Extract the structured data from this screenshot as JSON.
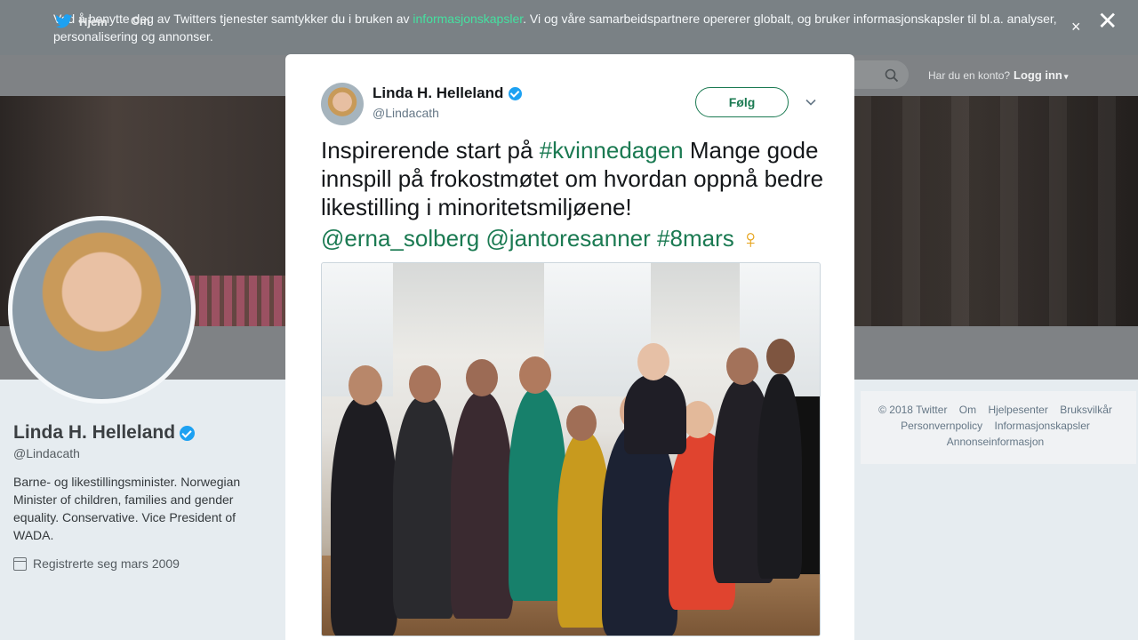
{
  "cookie_banner": {
    "text_before": "Ved å benytte deg av Twitters tjenester samtykker du i bruken av ",
    "link": "informasjonskapsler",
    "text_after": ". Vi og våre samarbeidspartnere opererer globalt, og bruker informasjonskapsler til bl.a. analyser, personalisering og annonser.",
    "close_small": "×",
    "close_big": "✕"
  },
  "nav": {
    "home": "Hjem",
    "about": "Om",
    "account_question": "Har du en konto?",
    "login": "Logg inn",
    "login_caret": "▾"
  },
  "profile": {
    "name": "Linda H. Helleland",
    "handle": "@Lindacath",
    "bio": "Barne- og likestillingsminister. Norwegian Minister of children, families and gender equality. Conservative. Vice President of WADA.",
    "joined": "Registrerte seg mars 2009"
  },
  "footer": {
    "copyright": "© 2018 Twitter",
    "about": "Om",
    "help": "Hjelpesenter",
    "terms": "Bruksvilkår",
    "privacy": "Personvernpolicy",
    "cookies": "Informasjonskapsler",
    "ads": "Annonseinformasjon"
  },
  "tweet": {
    "author_name": "Linda H. Helleland",
    "author_handle": "@Lindacath",
    "follow_label": "Følg",
    "text_part1": "Inspirerende start på ",
    "hashtag1": "#kvinnedagen",
    "text_part2": " Mange gode innspill på frokostmøtet om hvordan oppnå bedre likestilling i minoritetsmiljøene!",
    "mention1": "@erna_solberg",
    "mention2": "@jantoresanner",
    "hashtag2": "#8mars",
    "emoji": "♀"
  },
  "colors": {
    "link_green": "#1b7a52",
    "verified_blue": "#1da1f2",
    "emoji_gold": "#e6a31a"
  },
  "icons": [
    "twitter-bird-icon",
    "search-icon",
    "verified-icon",
    "calendar-icon",
    "chevron-down-icon",
    "close-icon"
  ]
}
